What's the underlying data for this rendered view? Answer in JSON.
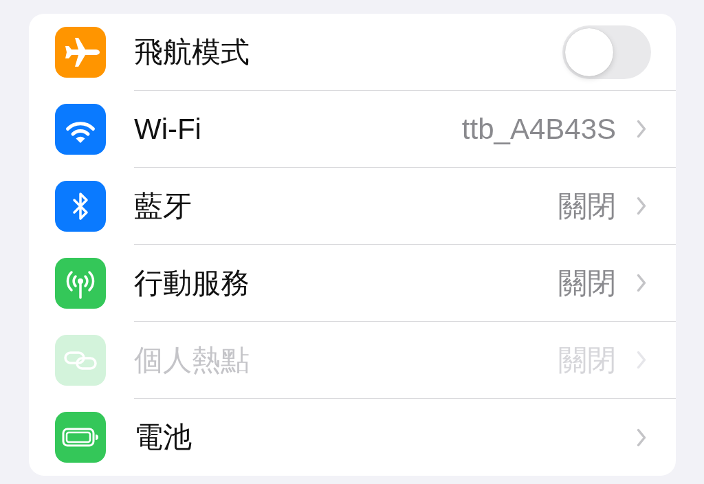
{
  "settings": [
    {
      "kind": "switch",
      "label": "飛航模式",
      "on": false,
      "disabled": false,
      "color": "#ff9500"
    },
    {
      "kind": "nav",
      "label": "Wi-Fi",
      "value": "ttb_A4B43S",
      "disabled": false,
      "color": "#0a7aff"
    },
    {
      "kind": "nav",
      "label": "藍牙",
      "value": "關閉",
      "disabled": false,
      "color": "#0a7aff"
    },
    {
      "kind": "nav",
      "label": "行動服務",
      "value": "關閉",
      "disabled": false,
      "color": "#34c759"
    },
    {
      "kind": "nav",
      "label": "個人熱點",
      "value": "關閉",
      "disabled": true,
      "color": "#d3f3db"
    },
    {
      "kind": "nav",
      "label": "電池",
      "disabled": false,
      "color": "#34c759"
    }
  ]
}
